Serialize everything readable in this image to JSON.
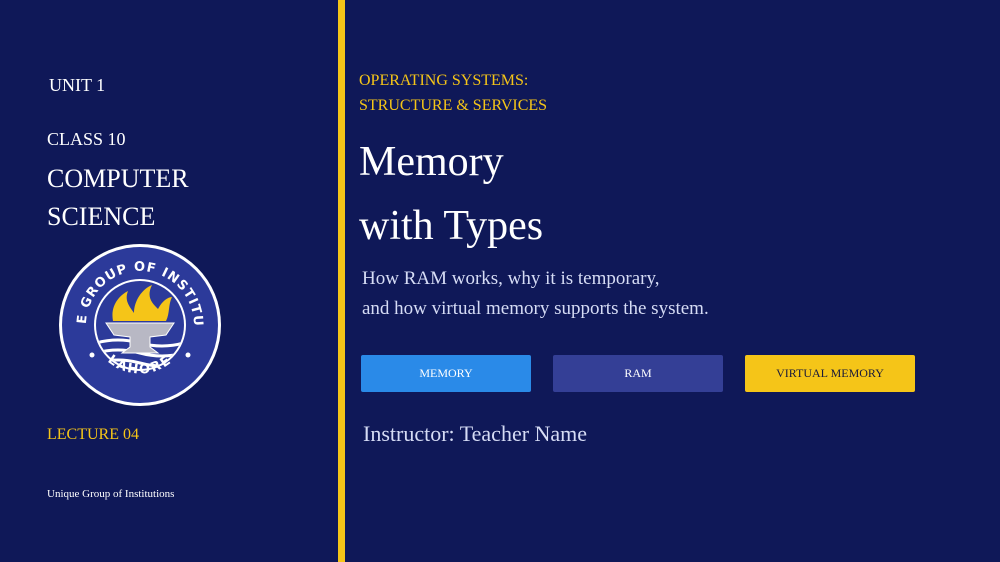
{
  "sidebar": {
    "unit": "UNIT 1",
    "class": "CLASS 10",
    "subject_line1": "COMPUTER",
    "subject_line2": "SCIENCE",
    "lecture": "LECTURE 04",
    "institution": "Unique Group of Institutions",
    "logo": {
      "ring_text": "UNIQUE GROUP OF INSTITUTIONS",
      "city": "LAHORE",
      "icon": "torch-anvil-emblem-icon"
    }
  },
  "main": {
    "kicker_line1": "OPERATING SYSTEMS:",
    "kicker_line2": "STRUCTURE & SERVICES",
    "title_line1": "Memory",
    "title_line2": "with Types",
    "subtitle_line1": "How RAM works, why it is temporary,",
    "subtitle_line2": "and how virtual memory supports the system.",
    "tags": [
      {
        "label": "MEMORY",
        "color": "#2a8ae8"
      },
      {
        "label": "RAM",
        "color": "#343f96"
      },
      {
        "label": "VIRTUAL MEMORY",
        "color": "#f5c518"
      }
    ],
    "instructor": "Instructor: Teacher Name"
  },
  "colors": {
    "background": "#0f1858",
    "accent": "#f5c518"
  }
}
